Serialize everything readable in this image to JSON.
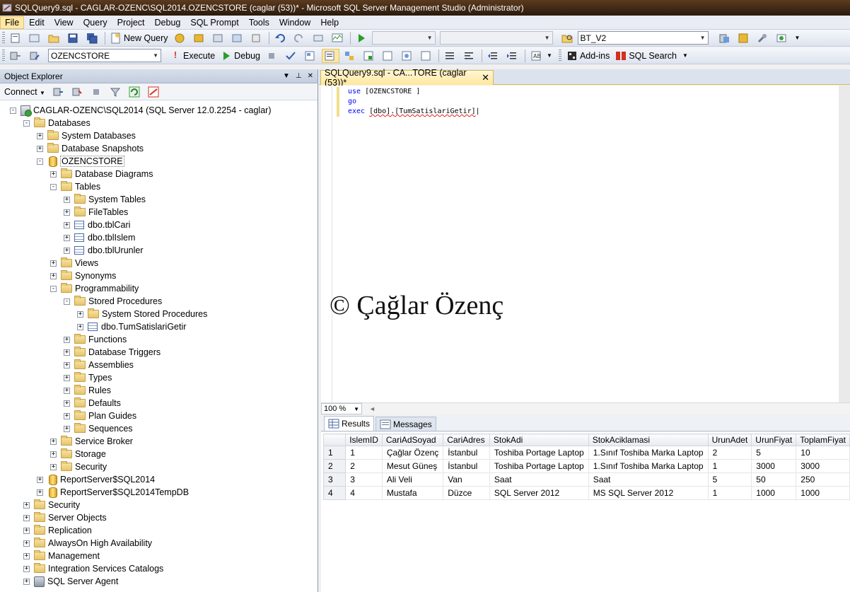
{
  "window": {
    "title": "SQLQuery9.sql - CAGLAR-OZENC\\SQL2014.OZENCSTORE  (caglar (53))* - Microsoft SQL Server Management Studio (Administrator)"
  },
  "menu": [
    "File",
    "Edit",
    "View",
    "Query",
    "Project",
    "Debug",
    "SQL Prompt",
    "Tools",
    "Window",
    "Help"
  ],
  "toolbar1": {
    "new_query": "New Query",
    "solution_combo": "BT_V2"
  },
  "toolbar2": {
    "database_combo": "OZENCSTORE",
    "execute": "Execute",
    "debug": "Debug",
    "addins": "Add-ins",
    "sql_search": "SQL Search"
  },
  "object_explorer": {
    "title": "Object Explorer",
    "connect": "Connect",
    "tree": [
      {
        "label": "CAGLAR-OZENC\\SQL2014 (SQL Server 12.0.2254 - caglar)",
        "level": 0,
        "icon": "server",
        "exp": "-"
      },
      {
        "label": "Databases",
        "level": 1,
        "icon": "folder",
        "exp": "-"
      },
      {
        "label": "System Databases",
        "level": 2,
        "icon": "folder",
        "exp": "+"
      },
      {
        "label": "Database Snapshots",
        "level": 2,
        "icon": "folder",
        "exp": "+"
      },
      {
        "label": "OZENCSTORE",
        "level": 2,
        "icon": "db",
        "exp": "-"
      },
      {
        "label": "Database Diagrams",
        "level": 3,
        "icon": "folder",
        "exp": "+"
      },
      {
        "label": "Tables",
        "level": 3,
        "icon": "folder",
        "exp": "-"
      },
      {
        "label": "System Tables",
        "level": 4,
        "icon": "folder",
        "exp": "+"
      },
      {
        "label": "FileTables",
        "level": 4,
        "icon": "folder",
        "exp": "+"
      },
      {
        "label": "dbo.tblCari",
        "level": 4,
        "icon": "table",
        "exp": "+"
      },
      {
        "label": "dbo.tblIslem",
        "level": 4,
        "icon": "table",
        "exp": "+"
      },
      {
        "label": "dbo.tblUrunler",
        "level": 4,
        "icon": "table",
        "exp": "+"
      },
      {
        "label": "Views",
        "level": 3,
        "icon": "folder",
        "exp": "+"
      },
      {
        "label": "Synonyms",
        "level": 3,
        "icon": "folder",
        "exp": "+"
      },
      {
        "label": "Programmability",
        "level": 3,
        "icon": "folder",
        "exp": "-"
      },
      {
        "label": "Stored Procedures",
        "level": 4,
        "icon": "folder",
        "exp": "-"
      },
      {
        "label": "System Stored Procedures",
        "level": 5,
        "icon": "folder",
        "exp": "+"
      },
      {
        "label": "dbo.TumSatislariGetir",
        "level": 5,
        "icon": "table",
        "exp": "+"
      },
      {
        "label": "Functions",
        "level": 4,
        "icon": "folder",
        "exp": "+"
      },
      {
        "label": "Database Triggers",
        "level": 4,
        "icon": "folder",
        "exp": "+"
      },
      {
        "label": "Assemblies",
        "level": 4,
        "icon": "folder",
        "exp": "+"
      },
      {
        "label": "Types",
        "level": 4,
        "icon": "folder",
        "exp": "+"
      },
      {
        "label": "Rules",
        "level": 4,
        "icon": "folder",
        "exp": "+"
      },
      {
        "label": "Defaults",
        "level": 4,
        "icon": "folder",
        "exp": "+"
      },
      {
        "label": "Plan Guides",
        "level": 4,
        "icon": "folder",
        "exp": "+"
      },
      {
        "label": "Sequences",
        "level": 4,
        "icon": "folder",
        "exp": "+"
      },
      {
        "label": "Service Broker",
        "level": 3,
        "icon": "folder",
        "exp": "+"
      },
      {
        "label": "Storage",
        "level": 3,
        "icon": "folder",
        "exp": "+"
      },
      {
        "label": "Security",
        "level": 3,
        "icon": "folder",
        "exp": "+"
      },
      {
        "label": "ReportServer$SQL2014",
        "level": 2,
        "icon": "db",
        "exp": "+"
      },
      {
        "label": "ReportServer$SQL2014TempDB",
        "level": 2,
        "icon": "db",
        "exp": "+"
      },
      {
        "label": "Security",
        "level": 1,
        "icon": "folder",
        "exp": "+"
      },
      {
        "label": "Server Objects",
        "level": 1,
        "icon": "folder",
        "exp": "+"
      },
      {
        "label": "Replication",
        "level": 1,
        "icon": "folder",
        "exp": "+"
      },
      {
        "label": "AlwaysOn High Availability",
        "level": 1,
        "icon": "folder",
        "exp": "+"
      },
      {
        "label": "Management",
        "level": 1,
        "icon": "folder",
        "exp": "+"
      },
      {
        "label": "Integration Services Catalogs",
        "level": 1,
        "icon": "folder",
        "exp": "+"
      },
      {
        "label": "SQL Server Agent",
        "level": 1,
        "icon": "agent",
        "exp": "+"
      }
    ]
  },
  "editor": {
    "tab_title": "SQLQuery9.sql - CA...TORE  (caglar (53))*",
    "line1_kw": "use",
    "line1_rest": "[OZENCSTORE ]",
    "line2": "go",
    "line3_kw": "exec",
    "line3_rest": "[dbo].[TumSatislariGetir]",
    "watermark": "© Çağlar Özenç",
    "zoom": "100 %"
  },
  "results": {
    "tabs": [
      "Results",
      "Messages"
    ],
    "columns": [
      "IslemID",
      "CariAdSoyad",
      "CariAdres",
      "StokAdi",
      "StokAciklamasi",
      "UrunAdet",
      "UrunFiyat",
      "ToplamFiyat"
    ],
    "rows": [
      [
        "1",
        "1",
        "Çağlar Özenç",
        "İstanbul",
        "Toshiba Portage Laptop",
        "1.Sınıf Toshiba Marka Laptop",
        "2",
        "5",
        "10"
      ],
      [
        "2",
        "2",
        "Mesut Güneş",
        "İstanbul",
        "Toshiba Portage Laptop",
        "1.Sınıf Toshiba Marka Laptop",
        "1",
        "3000",
        "3000"
      ],
      [
        "3",
        "3",
        "Ali Veli",
        "Van",
        "Saat",
        "Saat",
        "5",
        "50",
        "250"
      ],
      [
        "4",
        "4",
        "Mustafa",
        "Düzce",
        "SQL Server 2012",
        "MS SQL Server 2012",
        "1",
        "1000",
        "1000"
      ]
    ]
  }
}
